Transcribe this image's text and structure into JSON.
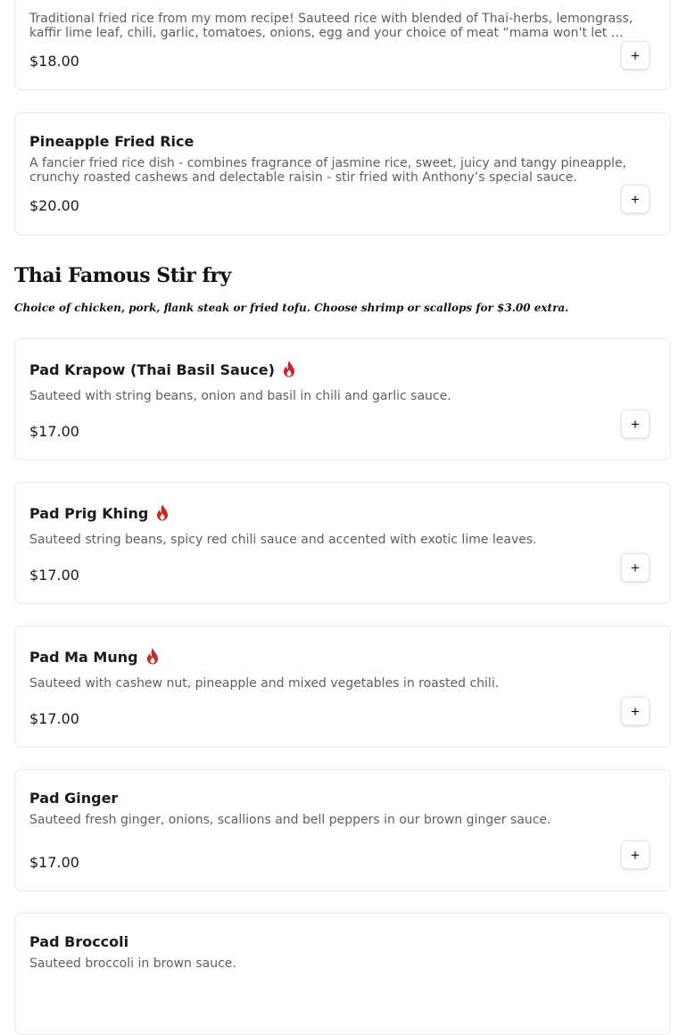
{
  "items_top": [
    {
      "description": "Traditional fried rice from my mom recipe! Sauteed rice with blended of Thai-herbs, lemongrass, kaffir lime leaf, chili, garlic, tomatoes, onions, egg and your choice of meat “mama won't let me starve”.",
      "price": "$18.00",
      "add_label": "+"
    },
    {
      "name": "Pineapple Fried Rice",
      "description": "A fancier fried rice dish - combines fragrance of jasmine rice, sweet, juicy and tangy pineapple, crunchy roasted cashews and delectable raisin - stir fried with Anthony’s special sauce.",
      "price": "$20.00",
      "add_label": "+"
    }
  ],
  "section": {
    "title": "Thai Famous Stir fry",
    "subtitle": "Choice of chicken, pork, flank steak or fried tofu. Choose shrimp or scallops for $3.00 extra."
  },
  "items": [
    {
      "name": "Pad Krapow (Thai Basil Sauce)",
      "spicy": true,
      "description": "Sauteed with string beans, onion and basil in chili and garlic sauce.",
      "price": "$17.00",
      "add_label": "+"
    },
    {
      "name": "Pad Prig Khing",
      "spicy": true,
      "description": "Sauteed string beans, spicy red chili sauce and accented with exotic lime leaves.",
      "price": "$17.00",
      "add_label": "+"
    },
    {
      "name": "Pad Ma Mung",
      "spicy": true,
      "description": "Sauteed with cashew nut, pineapple and mixed vegetables in roasted chili.",
      "price": "$17.00",
      "add_label": "+"
    },
    {
      "name": "Pad Ginger",
      "spicy": false,
      "description": "Sauteed fresh ginger, onions, scallions and bell peppers in our brown ginger sauce.",
      "price": "$17.00",
      "add_label": "+"
    },
    {
      "name": "Pad Broccoli",
      "spicy": false,
      "description": "Sauteed broccoli in brown sauce."
    }
  ],
  "colors": {
    "flame": "#c62828",
    "border": "#e8e8e8",
    "description": "#5f5f5f"
  },
  "icons": {
    "spicy": "flame-icon",
    "add": "plus-icon"
  }
}
